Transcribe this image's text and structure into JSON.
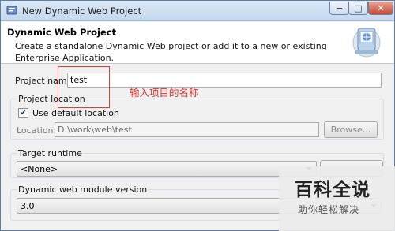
{
  "window": {
    "title": "New Dynamic Web Project",
    "controls": {
      "minimize": "−",
      "maximize": "□",
      "close": "✕"
    }
  },
  "header": {
    "title": "Dynamic Web Project",
    "description": "Create a standalone Dynamic Web project or add it to a new or existing Enterprise Application.",
    "image_icon": "web-project-wizard-icon"
  },
  "form": {
    "project_name_label": "Project name:",
    "project_name_value": "test",
    "project_location": {
      "group_title": "Project location",
      "use_default_label": "Use default location",
      "use_default_checked": "✔",
      "location_label": "Location:",
      "location_value": "D:\\work\\web\\test",
      "browse_label": "Browse..."
    },
    "target_runtime": {
      "group_title": "Target runtime",
      "selected": "<None>"
    },
    "module_version": {
      "group_title": "Dynamic web module version",
      "selected": "3.0"
    }
  },
  "annotation": {
    "text": "输入项目的名称",
    "color": "#e53b2f"
  },
  "watermark": {
    "main": "百科全说",
    "sub": "助你轻松解决"
  }
}
